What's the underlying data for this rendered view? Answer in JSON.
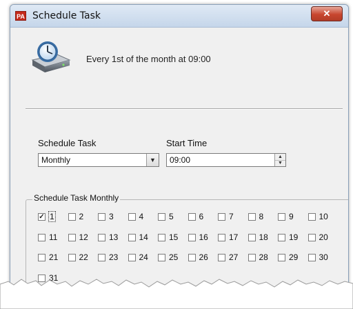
{
  "window": {
    "title": "Schedule Task",
    "app_icon": "PA",
    "close_icon": "✕"
  },
  "summary": "Every 1st of the month at 09:00",
  "schedule": {
    "label": "Schedule Task",
    "value": "Monthly",
    "arrow": "▼"
  },
  "start_time": {
    "label": "Start Time",
    "value": "09:00",
    "spin_up": "▲",
    "spin_down": "▼"
  },
  "monthly_group": {
    "legend": "Schedule Task Monthly",
    "checked_mark": "✓",
    "days": [
      "1",
      "2",
      "3",
      "4",
      "5",
      "6",
      "7",
      "8",
      "9",
      "10",
      "11",
      "12",
      "13",
      "14",
      "15",
      "16",
      "17",
      "18",
      "19",
      "20",
      "21",
      "22",
      "23",
      "24",
      "25",
      "26",
      "27",
      "28",
      "29",
      "30",
      "31"
    ],
    "checked": [
      "1"
    ]
  },
  "icons": {
    "clock": "clock-drive-icon"
  }
}
